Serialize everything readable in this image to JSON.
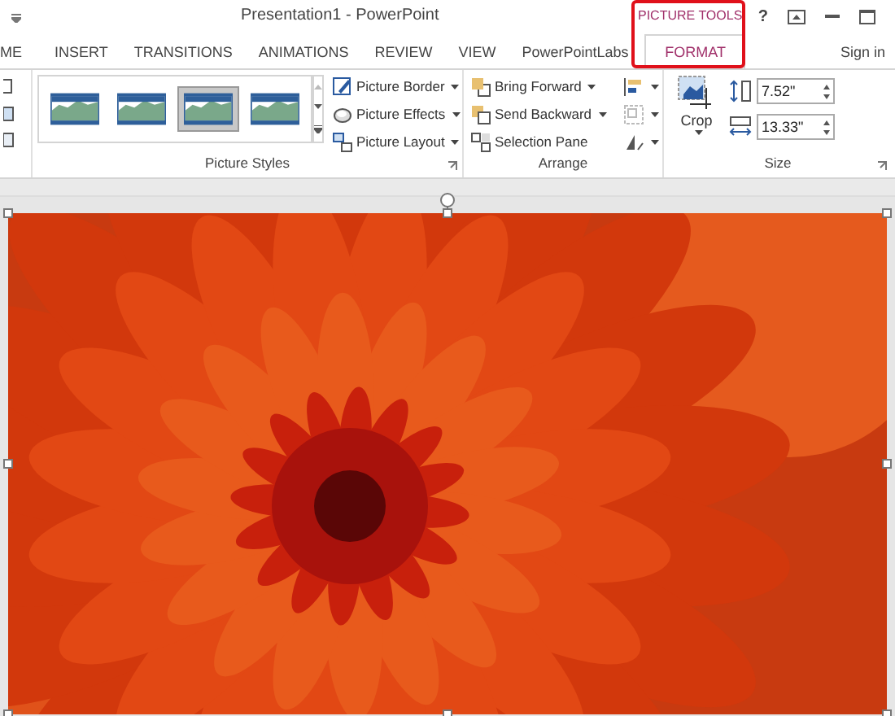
{
  "window": {
    "title": "Presentation1 - PowerPoint",
    "contextual_group": "PICTURE TOOLS",
    "help": "?"
  },
  "tabs": [
    {
      "label": "ME",
      "selected": false
    },
    {
      "label": "INSERT",
      "selected": false
    },
    {
      "label": "TRANSITIONS",
      "selected": false
    },
    {
      "label": "ANIMATIONS",
      "selected": false
    },
    {
      "label": "REVIEW",
      "selected": false
    },
    {
      "label": "VIEW",
      "selected": false
    },
    {
      "label": "PowerPointLabs",
      "selected": false
    },
    {
      "label": "FORMAT",
      "selected": true,
      "contextual": true
    }
  ],
  "sign_in": "Sign in",
  "picture_styles": {
    "label": "Picture Styles",
    "thumbnails": [
      {
        "selected": false
      },
      {
        "selected": false
      },
      {
        "selected": true
      },
      {
        "selected": false
      }
    ],
    "commands": [
      "Picture Border",
      "Picture Effects",
      "Picture Layout"
    ]
  },
  "arrange": {
    "label": "Arrange",
    "commands": [
      "Bring Forward",
      "Send Backward",
      "Selection Pane"
    ]
  },
  "size": {
    "label": "Size",
    "crop": "Crop",
    "height": "7.52\"",
    "width": "13.33\""
  },
  "slide": {
    "picture": {
      "kind": "picture",
      "selected": true
    }
  }
}
